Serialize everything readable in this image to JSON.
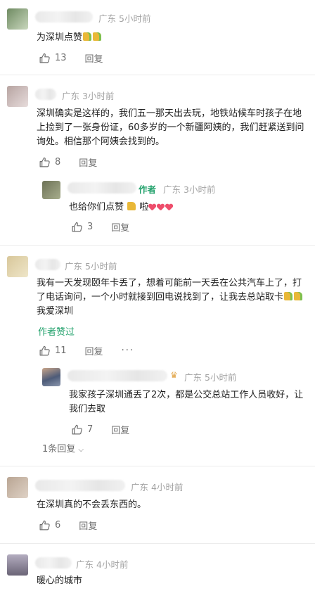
{
  "comments": [
    {
      "region": "广东",
      "time": "5小时前",
      "text": "为深圳点赞",
      "likes": "13",
      "reply_label": "回复",
      "avatar_colors": [
        "#6f8b62",
        "#c9d7bd"
      ]
    },
    {
      "region": "广东",
      "time": "3小时前",
      "text": "深圳确实是这样的，我们五一那天出去玩，地铁站候车时孩子在地上捡到了一张身份证，60多岁的一个新疆阿姨的，我们赶紧送到问询处。相信那个阿姨会找到的。",
      "likes": "8",
      "reply_label": "回复",
      "avatar_colors": [
        "#b7a4a1",
        "#e7dcdc"
      ],
      "sub_reply": {
        "author_tag": "作者",
        "region": "广东",
        "time": "3小时前",
        "text": "也给你们点赞",
        "text_suffix": "啦",
        "likes": "3",
        "reply_label": "回复",
        "avatar_colors": [
          "#6d7257",
          "#a7ad8c"
        ]
      }
    },
    {
      "region": "广东",
      "time": "5小时前",
      "text": "我有一天发现颐年卡丢了，想着可能前一天丢在公共汽车上了，打了电话询问，一个小时就接到回电说找到了，让我去总站取卡",
      "text_suffix": "我爱深圳",
      "author_liked": "作者赞过",
      "likes": "11",
      "reply_label": "回复",
      "more_label": "···",
      "avatar_colors": [
        "#d8c79a",
        "#efe6c9"
      ],
      "sub_reply": {
        "region": "广东",
        "time": "5小时前",
        "text": "我家孩子深圳通丢了2次，都是公交总站工作人员收好，让我们去取",
        "likes": "7",
        "reply_label": "回复",
        "avatar_colors": [
          "#4d5b78",
          "#c9a58a"
        ]
      },
      "reply_count_label": "1条回复"
    },
    {
      "region": "广东",
      "time": "4小时前",
      "text": "在深圳真的不会丢东西的。",
      "likes": "6",
      "reply_label": "回复",
      "avatar_colors": [
        "#b9a593",
        "#dfd2c6"
      ]
    },
    {
      "region": "广东",
      "time": "4小时前",
      "text": "暖心的城市",
      "avatar_colors": [
        "#6a6476",
        "#b4adc0"
      ]
    }
  ]
}
